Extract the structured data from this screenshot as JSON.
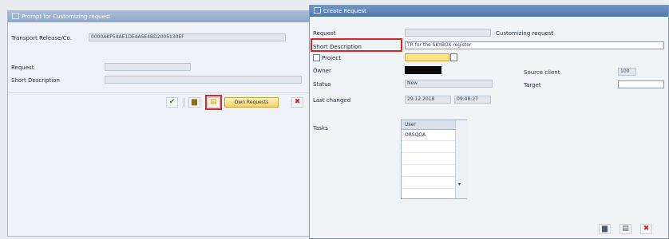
{
  "left_dialog": {
    "title": "Prompt for Customizing request",
    "transport_release_label": "Transport Release/Co.",
    "transport_release_value": "0000AKP54AE1DE4A5E4BD2005130EF",
    "request_label": "Request",
    "short_description_label": "Short Description",
    "own_requests_label": "Own Requests"
  },
  "right_dialog": {
    "title": "Create Request",
    "request_label": "Request",
    "request_type": "Customizing request",
    "short_description_label": "Short Description",
    "short_description_value": "TR for the SKYBOX register",
    "project_label": "Project",
    "owner_label": "Owner",
    "status_label": "Status",
    "status_value": "New",
    "last_changed_label": "Last changed",
    "last_changed_date": "29.12.2018",
    "last_changed_time": "09:48:27",
    "source_client_label": "Source client",
    "source_client_value": "100",
    "target_label": "Target",
    "tasks_label": "Tasks",
    "tasks_column": "User",
    "tasks_rows": [
      "ORSQOA"
    ]
  },
  "colors": {
    "title_bar": "#5f86b8",
    "highlight_box": "#e02424",
    "project_field": "#ffe48a"
  }
}
